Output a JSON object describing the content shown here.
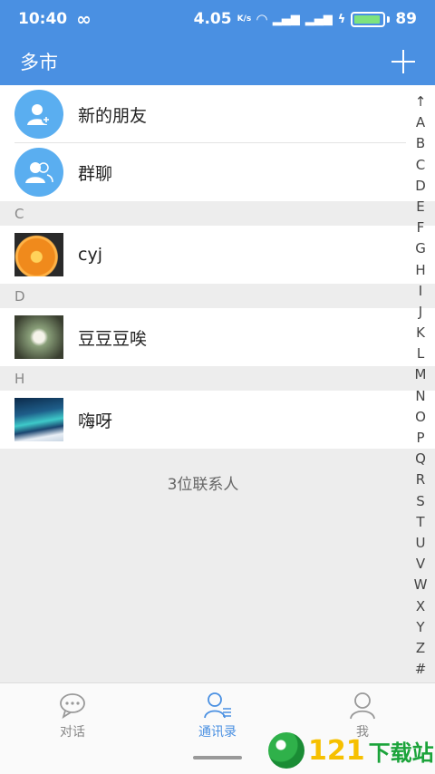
{
  "status": {
    "time": "10:40",
    "net_speed": "4.05",
    "net_unit": "K/s",
    "battery": "89"
  },
  "header": {
    "title": "多市"
  },
  "special_rows": [
    {
      "label": "新的朋友",
      "icon": "new-friend-icon"
    },
    {
      "label": "群聊",
      "icon": "group-chat-icon"
    }
  ],
  "sections": [
    {
      "letter": "C",
      "contact": {
        "name": "cyj",
        "avatar": "orange-slice-photo"
      }
    },
    {
      "letter": "D",
      "contact": {
        "name": "豆豆豆唉",
        "avatar": "flowers-photo"
      }
    },
    {
      "letter": "H",
      "contact": {
        "name": "嗨呀",
        "avatar": "aurora-photo"
      }
    }
  ],
  "contact_count": "3位联系人",
  "alphabet": [
    "↑",
    "A",
    "B",
    "C",
    "D",
    "E",
    "F",
    "G",
    "H",
    "I",
    "J",
    "K",
    "L",
    "M",
    "N",
    "O",
    "P",
    "Q",
    "R",
    "S",
    "T",
    "U",
    "V",
    "W",
    "X",
    "Y",
    "Z",
    "#"
  ],
  "bottom_nav": [
    {
      "label": "对话",
      "icon": "chat-icon",
      "active": false
    },
    {
      "label": "通讯录",
      "icon": "contacts-icon",
      "active": true
    },
    {
      "label": "我",
      "icon": "profile-icon",
      "active": false
    }
  ],
  "watermark": {
    "number": "121",
    "text": "下载站",
    "url": "121down.com"
  },
  "colors": {
    "primary": "#4a90e2",
    "background": "#ededed"
  }
}
